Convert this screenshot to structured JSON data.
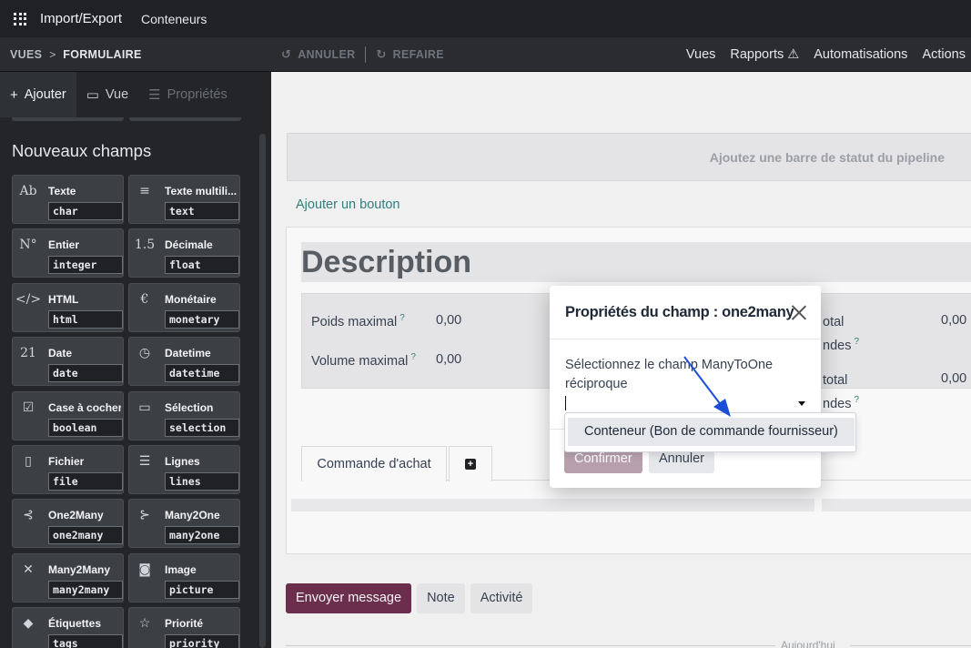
{
  "navbar": {
    "brand": "Import/Export",
    "menu": "Conteneurs"
  },
  "studio": {
    "breadcrumb": [
      "VUES",
      "FORMULAIRE"
    ],
    "undo_label": "ANNULER",
    "redo_label": "REFAIRE",
    "right_menu": [
      "Vues",
      "Rapports",
      "Automatisations",
      "Actions"
    ]
  },
  "sidebar": {
    "tabs": {
      "add": "Ajouter",
      "view": "Vue",
      "properties": "Propriétés"
    },
    "section_title": "Nouveaux champs",
    "fields": [
      {
        "icon": "text-icon",
        "glyph": "Ab",
        "label": "Texte",
        "type": "char"
      },
      {
        "icon": "multiline-text-icon",
        "glyph": "≡",
        "label": "Texte multili...",
        "type": "text"
      },
      {
        "icon": "integer-icon",
        "glyph": "N°",
        "label": "Entier",
        "type": "integer"
      },
      {
        "icon": "decimal-icon",
        "glyph": "1.5",
        "label": "Décimale",
        "type": "float"
      },
      {
        "icon": "html-icon",
        "glyph": "</>",
        "label": "HTML",
        "type": "html"
      },
      {
        "icon": "monetary-icon",
        "glyph": "€",
        "label": "Monétaire",
        "type": "monetary"
      },
      {
        "icon": "calendar-icon",
        "glyph": "21",
        "label": "Date",
        "type": "date"
      },
      {
        "icon": "clock-icon",
        "glyph": "◷",
        "label": "Datetime",
        "type": "datetime"
      },
      {
        "icon": "checkbox-icon",
        "glyph": "☑",
        "label": "Case à cocher",
        "type": "boolean"
      },
      {
        "icon": "selection-icon",
        "glyph": "▭",
        "label": "Sélection",
        "type": "selection"
      },
      {
        "icon": "file-icon",
        "glyph": "▯",
        "label": "Fichier",
        "type": "file"
      },
      {
        "icon": "lines-icon",
        "glyph": "☰",
        "label": "Lignes",
        "type": "lines"
      },
      {
        "icon": "one2many-icon",
        "glyph": "⊰",
        "label": "One2Many",
        "type": "one2many"
      },
      {
        "icon": "many2one-icon",
        "glyph": "⊱",
        "label": "Many2One",
        "type": "many2one"
      },
      {
        "icon": "many2many-icon",
        "glyph": "✕",
        "label": "Many2Many",
        "type": "many2many"
      },
      {
        "icon": "camera-icon",
        "glyph": "◙",
        "label": "Image",
        "type": "picture"
      },
      {
        "icon": "tag-icon",
        "glyph": "◆",
        "label": "Étiquettes",
        "type": "tags"
      },
      {
        "icon": "star-icon",
        "glyph": "☆",
        "label": "Priorité",
        "type": "priority"
      }
    ]
  },
  "form": {
    "pipeline_placeholder": "Ajoutez une barre de statut du pipeline",
    "add_button": "Ajouter un bouton",
    "title": "Description",
    "fields": [
      {
        "label": "Poids maximal",
        "help": "?",
        "value": "0,00"
      },
      {
        "label": "Volume maximal",
        "help": "?",
        "value": "0,00"
      }
    ],
    "right_fields": [
      {
        "label_line1": "otal",
        "label_line2": "ndes",
        "help": "?",
        "value": "0,00"
      },
      {
        "label_line1": "total",
        "label_line2": "ndes",
        "help": "?",
        "value": "0,00"
      }
    ],
    "tab_label": "Commande d'achat",
    "tab_add_symbol": "+"
  },
  "chatter": {
    "send_message": "Envoyer message",
    "note": "Note",
    "activity": "Activité",
    "today": "Aujourd'hui"
  },
  "modal": {
    "title": "Propriétés du champ : one2many",
    "label": "Sélectionnez le champ ManyToOne réciproque",
    "select_value": "",
    "confirm": "Confirmer",
    "cancel": "Annuler",
    "dropdown_options": [
      "Conteneur (Bon de commande fournisseur)"
    ]
  },
  "colors": {
    "navbar": "#1f2124",
    "primary": "#6b2f4d",
    "link": "#2f7f7a",
    "annotation_arrow": "#1d4ed8"
  }
}
